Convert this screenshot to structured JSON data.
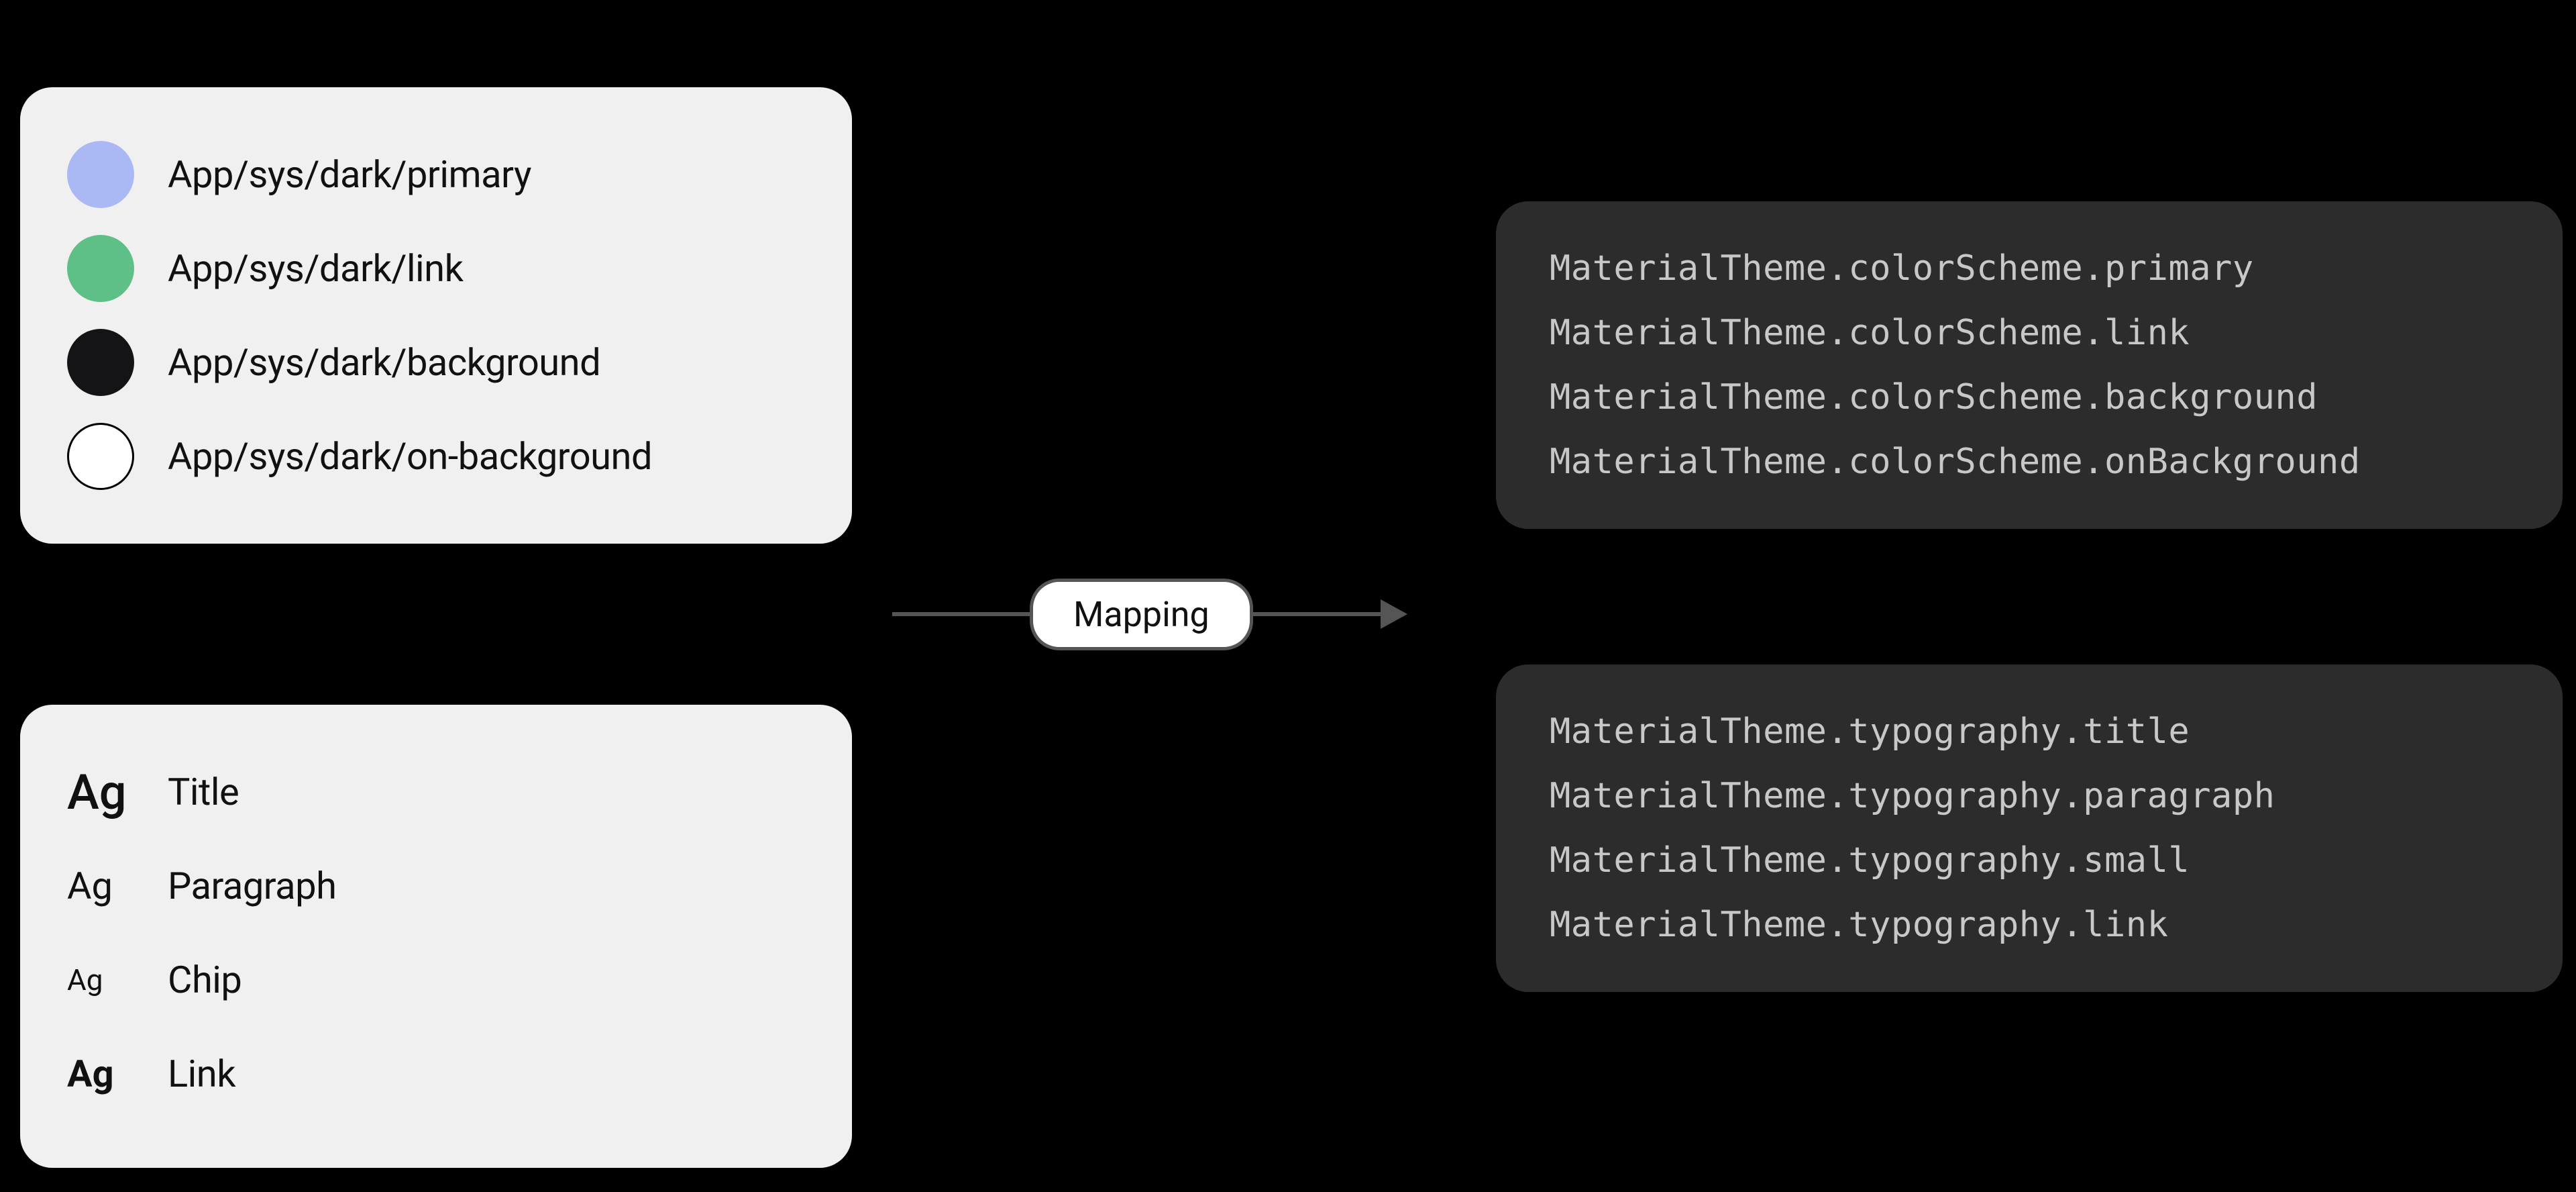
{
  "swatches": {
    "primary": "#aab9f4",
    "link": "#5ec087",
    "background": "#141416",
    "onBackground": "#ffffff"
  },
  "left": {
    "colors": {
      "primary": "App/sys/dark/primary",
      "link": "App/sys/dark/link",
      "background": "App/sys/dark/background",
      "onBackground": "App/sys/dark/on-background"
    },
    "typeGlyph": "Ag",
    "typography": {
      "title": "Title",
      "paragraph": "Paragraph",
      "chip": "Chip",
      "link": "Link"
    }
  },
  "mappingLabel": "Mapping",
  "right": {
    "colors": {
      "primary": "MaterialTheme.colorScheme.primary",
      "link": "MaterialTheme.colorScheme.link",
      "background": "MaterialTheme.colorScheme.background",
      "onBackground": "MaterialTheme.colorScheme.onBackground"
    },
    "typography": {
      "title": "MaterialTheme.typography.title",
      "paragraph": "MaterialTheme.typography.paragraph",
      "small": "MaterialTheme.typography.small",
      "link": "MaterialTheme.typography.link"
    }
  }
}
